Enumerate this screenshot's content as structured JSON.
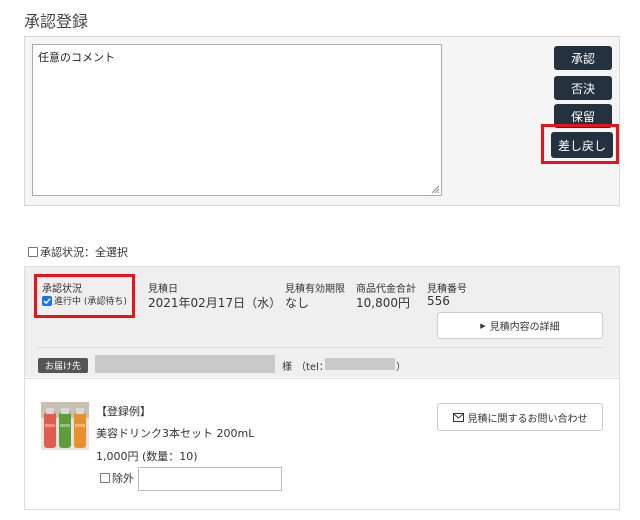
{
  "page": {
    "title": "承認登録"
  },
  "comment": {
    "value": "任意のコメント"
  },
  "actions": {
    "approve": "承認",
    "reject": "否決",
    "hold": "保留",
    "send_back": "差し戻し"
  },
  "select_all": {
    "label": "承認状況：全選択"
  },
  "order": {
    "status_label": "承認状況",
    "status_value": "進行中 (承認待ち)",
    "status_checked": true,
    "date_label": "見積日",
    "date_value": "2021年02月17日（水）",
    "expiry_label": "見積有効期限",
    "expiry_value": "なし",
    "total_label": "商品代金合計",
    "total_value": "10,800円",
    "number_label": "見積番号",
    "number_value": "556",
    "detail_button": "見積内容の詳細"
  },
  "delivery": {
    "badge": "お届け先",
    "suffix": "様",
    "tel_prefix": "（tel：",
    "tel_suffix": "）"
  },
  "product": {
    "tag": "【登録例】",
    "name": "美容ドリンク3本セット 200mL",
    "price": "1,000円 (数量：10)",
    "exclude_label": "除外",
    "inquiry_button": "見積に関するお問い合わせ"
  },
  "colors": {
    "action_button": "#243240",
    "highlight": "#e8131b",
    "checkbox": "#1a73e8"
  }
}
